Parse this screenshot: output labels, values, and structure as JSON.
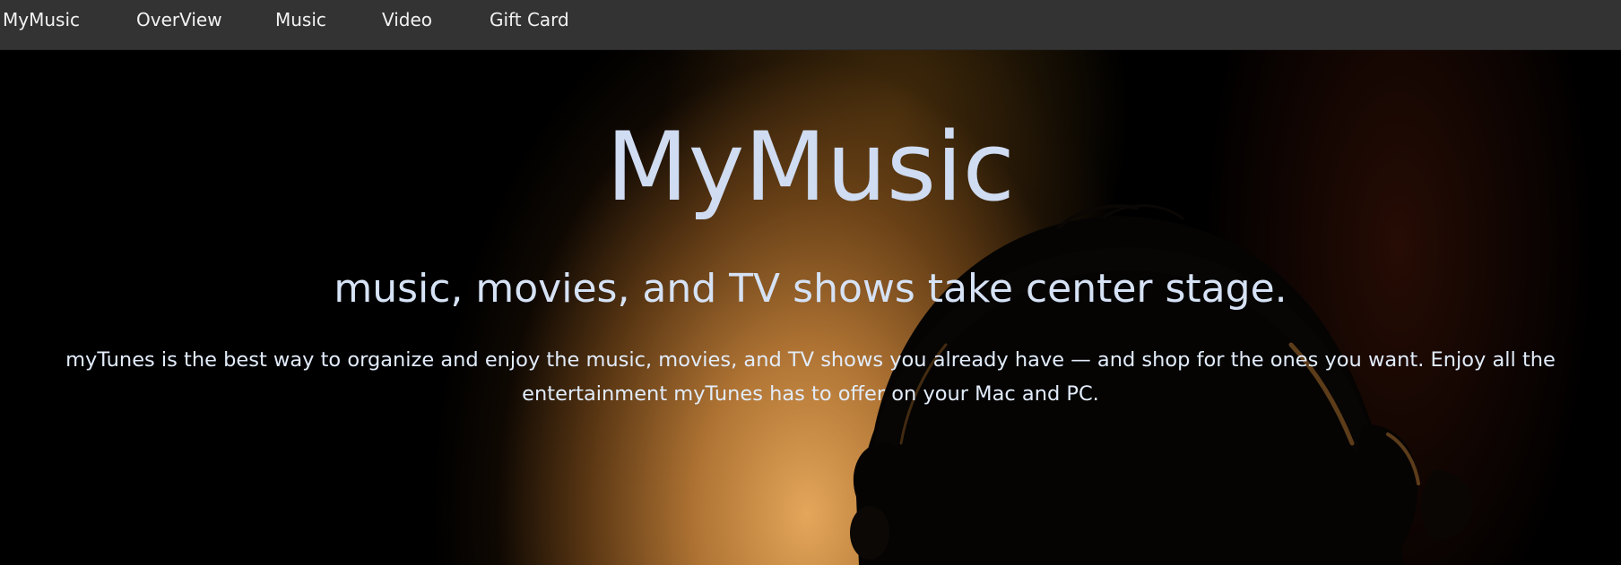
{
  "nav": {
    "brand": "MyMusic",
    "items": [
      {
        "label": "OverView"
      },
      {
        "label": "Music"
      },
      {
        "label": "Video"
      },
      {
        "label": "Gift Card"
      }
    ]
  },
  "hero": {
    "title": "MyMusic",
    "subtitle": "music, movies, and TV shows take center stage.",
    "description": "myTunes is the best way to organize and enjoy the music, movies, and TV shows you already have — and shop for the ones you want. Enjoy all the entertainment myTunes has to offer on your Mac and PC."
  },
  "colors": {
    "navbar_bg": "#333333",
    "nav_text": "#f2f2f2",
    "hero_text": "#cfdcf2",
    "hero_glow": "#f0af5f"
  }
}
